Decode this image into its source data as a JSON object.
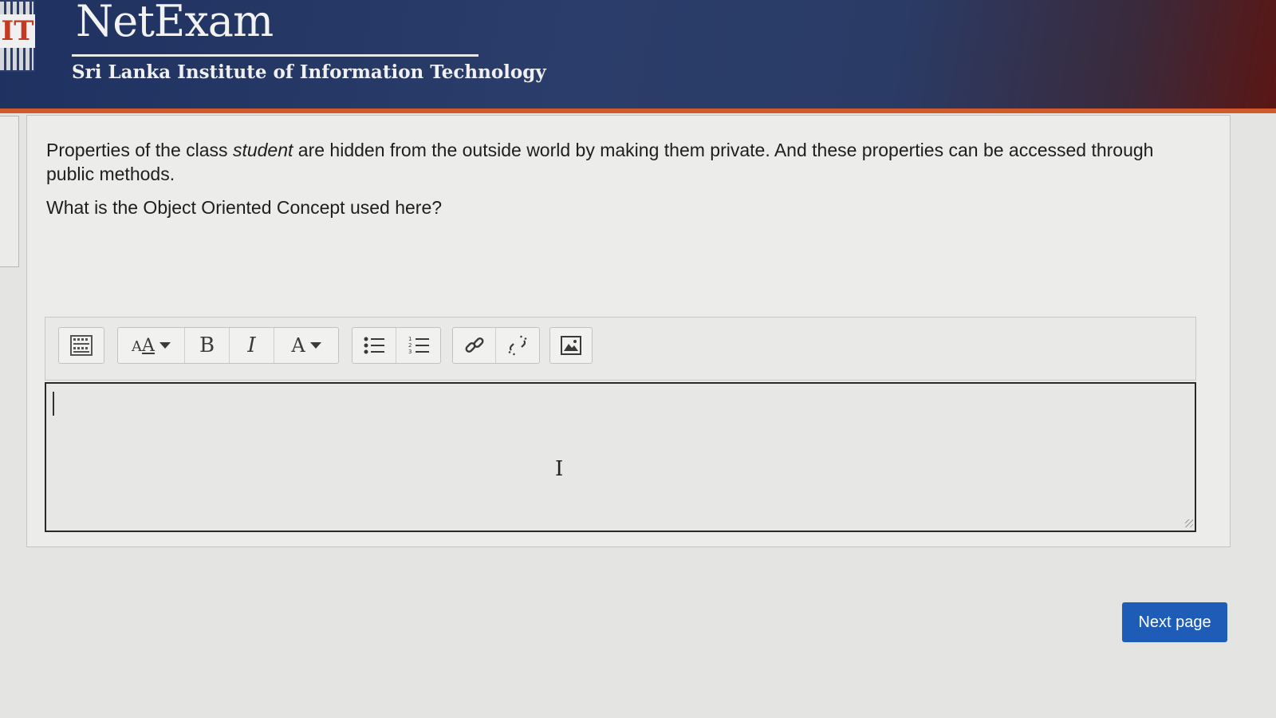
{
  "header": {
    "logo_text": "IT",
    "brand_title": "NetExam",
    "institute": "Sri Lanka Institute of Information Technology"
  },
  "question": {
    "line1_before": "Properties of the class ",
    "line1_emphasis": "student",
    "line1_after": " are hidden from the outside world by making them private. And these properties can be accessed through public methods.",
    "prompt": "What is the Object Oriented Concept used here?"
  },
  "editor": {
    "toolbar": {
      "groups": [
        [
          "toolbar-toggle-icon"
        ],
        [
          "font-size-icon",
          "bold-icon",
          "italic-icon",
          "font-color-icon"
        ],
        [
          "bulleted-list-icon",
          "numbered-list-icon"
        ],
        [
          "link-icon",
          "unlink-icon"
        ],
        [
          "image-icon"
        ]
      ],
      "bold_glyph": "B",
      "italic_glyph": "I",
      "font_color_glyph": "A",
      "font_size_glyph": "A",
      "font_size_sub_glyph": "A"
    },
    "answer_value": ""
  },
  "navigation": {
    "next_label": "Next page"
  },
  "colors": {
    "header_bg": "#2b3d6a",
    "accent_stripe": "#d05a2a",
    "primary_button": "#1f5cb8"
  }
}
